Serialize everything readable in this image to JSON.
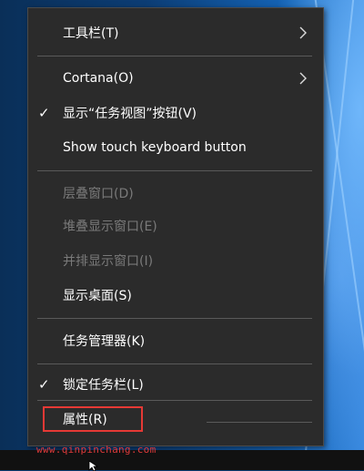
{
  "menu": {
    "items": [
      {
        "label": "工具栏(T)",
        "checked": false,
        "disabled": false,
        "submenu": true
      },
      {
        "label": "Cortana(O)",
        "checked": false,
        "disabled": false,
        "submenu": true
      },
      {
        "label": "显示“任务视图”按钮(V)",
        "checked": true,
        "disabled": false,
        "submenu": false
      },
      {
        "label": "Show touch keyboard button",
        "checked": false,
        "disabled": false,
        "submenu": false
      },
      {
        "label": "层叠窗口(D)",
        "checked": false,
        "disabled": true,
        "submenu": false
      },
      {
        "label": "堆叠显示窗口(E)",
        "checked": false,
        "disabled": true,
        "submenu": false
      },
      {
        "label": "并排显示窗口(I)",
        "checked": false,
        "disabled": true,
        "submenu": false
      },
      {
        "label": "显示桌面(S)",
        "checked": false,
        "disabled": false,
        "submenu": false
      },
      {
        "label": "任务管理器(K)",
        "checked": false,
        "disabled": false,
        "submenu": false
      },
      {
        "label": "锁定任务栏(L)",
        "checked": true,
        "disabled": false,
        "submenu": false
      },
      {
        "label": "属性(R)",
        "checked": false,
        "disabled": false,
        "submenu": false,
        "highlighted": true
      }
    ],
    "check_glyph": "✓"
  },
  "watermark": {
    "text": "www.qinpinchang.com",
    "color": "#e03a3a"
  },
  "colors": {
    "menu_bg": "#2b2b2b",
    "text": "#ffffff",
    "disabled_text": "#7a7a7a",
    "highlight_border": "#e53935"
  }
}
